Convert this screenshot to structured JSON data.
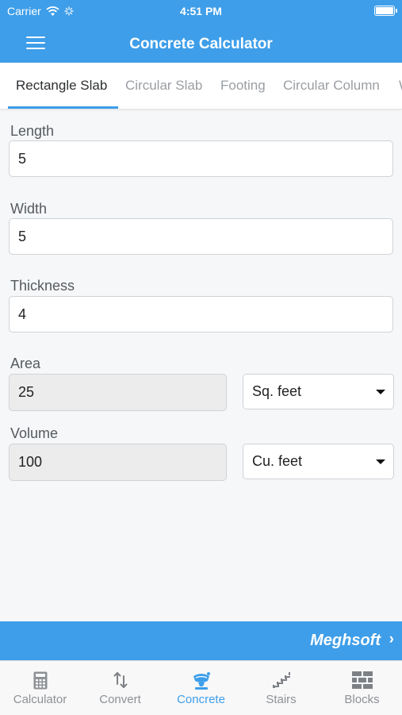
{
  "status_bar": {
    "carrier": "Carrier",
    "time": "4:51 PM"
  },
  "header": {
    "title": "Concrete Calculator"
  },
  "tabs": [
    {
      "label": "Rectangle Slab",
      "active": true
    },
    {
      "label": "Circular Slab",
      "active": false
    },
    {
      "label": "Footing",
      "active": false
    },
    {
      "label": "Circular Column",
      "active": false
    },
    {
      "label": "W",
      "active": false
    }
  ],
  "form": {
    "length": {
      "label": "Length",
      "value": "5"
    },
    "width": {
      "label": "Width",
      "value": "5"
    },
    "thickness": {
      "label": "Thickness",
      "value": "4"
    },
    "area": {
      "label": "Area",
      "value": "25",
      "unit": "Sq. feet"
    },
    "volume": {
      "label": "Volume",
      "value": "100",
      "unit": "Cu. feet"
    }
  },
  "banner": {
    "brand": "Meghsoft",
    "chevron": "›"
  },
  "tabbar": [
    {
      "label": "Calculator",
      "icon": "calculator-icon",
      "active": false
    },
    {
      "label": "Convert",
      "icon": "convert-arrows-icon",
      "active": false
    },
    {
      "label": "Concrete",
      "icon": "concrete-mixer-icon",
      "active": true
    },
    {
      "label": "Stairs",
      "icon": "stairs-icon",
      "active": false
    },
    {
      "label": "Blocks",
      "icon": "bricks-icon",
      "active": false
    }
  ],
  "colors": {
    "accent": "#3e9ee9",
    "inactive": "#8d9196"
  }
}
